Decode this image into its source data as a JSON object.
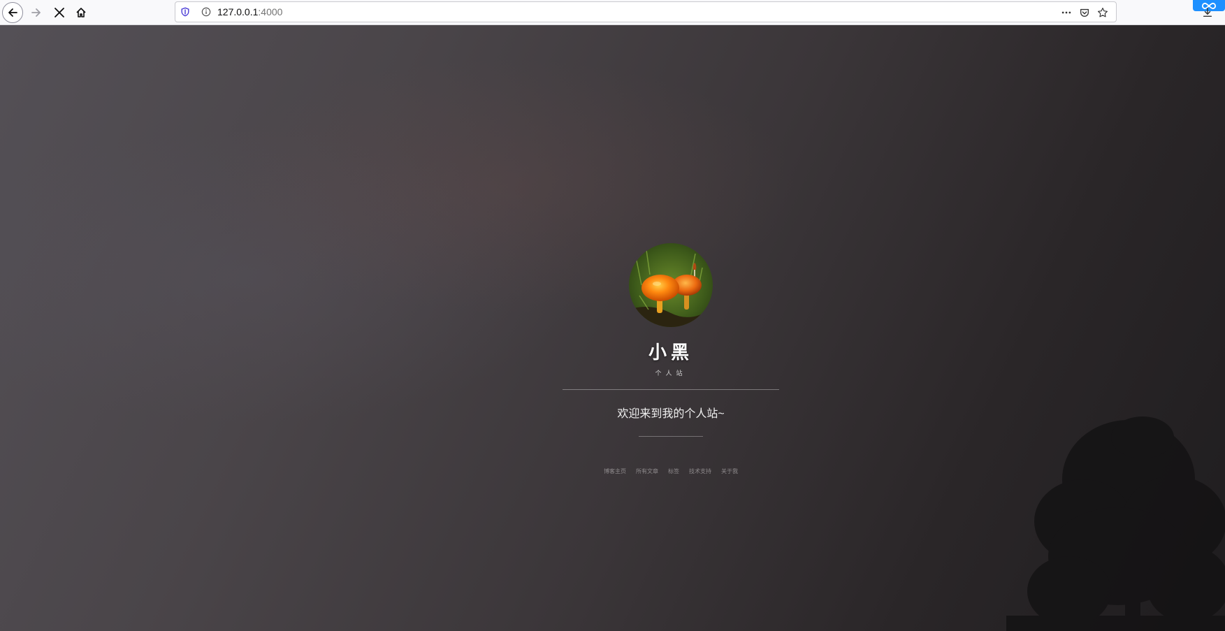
{
  "browser": {
    "url_host": "127.0.0.1",
    "url_port": ":4000",
    "icons": {
      "back": "arrow-left-icon",
      "forward": "arrow-right-icon",
      "stop": "close-icon",
      "home": "home-icon",
      "shield": "shield-icon",
      "info": "info-icon",
      "more": "more-icon",
      "pocket": "pocket-icon",
      "bookmark": "star-icon",
      "download": "download-icon"
    },
    "colors": {
      "toolbar": "#f9f9fb",
      "shield_accent": "#4a3cd6",
      "extension_badge": "#1e90ff"
    }
  },
  "profile": {
    "title": "小黑",
    "subtitle": "个人站",
    "welcome": "欢迎来到我的个人站~",
    "avatar": "mushroom-avatar"
  },
  "nav": {
    "links": [
      "博客主页",
      "所有文章",
      "标签",
      "技术支持",
      "关于我"
    ]
  }
}
